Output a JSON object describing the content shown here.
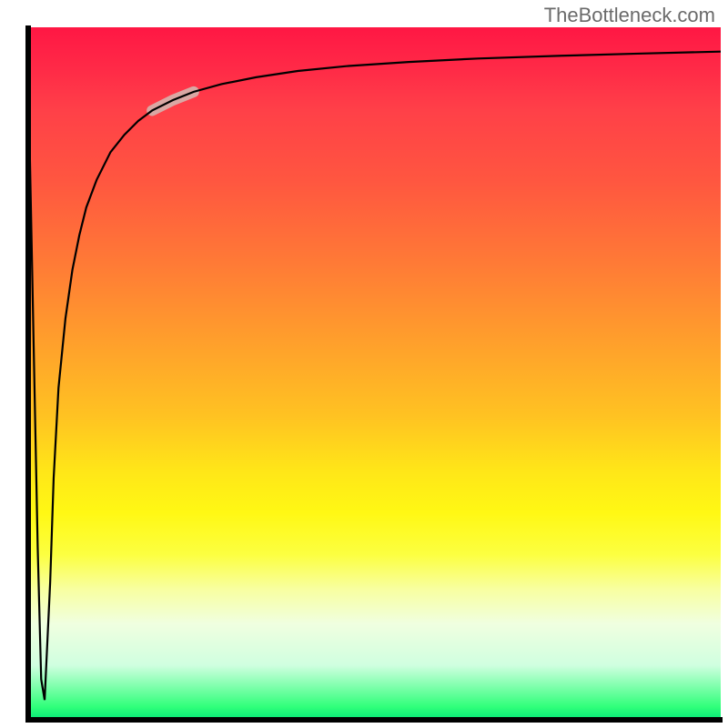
{
  "watermark": "TheBottleneck.com",
  "chart_data": {
    "type": "line",
    "title": "",
    "xlabel": "",
    "ylabel": "",
    "xlim": [
      0,
      100
    ],
    "ylim": [
      0,
      100
    ],
    "grid": false,
    "legend": false,
    "gradient_stops": [
      {
        "pos": 0.0,
        "color": "#ff1744"
      },
      {
        "pos": 0.06,
        "color": "#ff2a47"
      },
      {
        "pos": 0.12,
        "color": "#ff4048"
      },
      {
        "pos": 0.22,
        "color": "#ff5640"
      },
      {
        "pos": 0.34,
        "color": "#ff7a36"
      },
      {
        "pos": 0.45,
        "color": "#ff9e2c"
      },
      {
        "pos": 0.56,
        "color": "#ffc222"
      },
      {
        "pos": 0.64,
        "color": "#ffe618"
      },
      {
        "pos": 0.7,
        "color": "#fff814"
      },
      {
        "pos": 0.76,
        "color": "#fcff40"
      },
      {
        "pos": 0.81,
        "color": "#f8ffa0"
      },
      {
        "pos": 0.86,
        "color": "#f0ffe0"
      },
      {
        "pos": 0.92,
        "color": "#d0ffe0"
      },
      {
        "pos": 0.98,
        "color": "#30ff7a"
      },
      {
        "pos": 1.0,
        "color": "#00e676"
      }
    ],
    "series": [
      {
        "name": "bottleneck-curve",
        "x": [
          0.0,
          0.8,
          1.5,
          2.0,
          2.5,
          3.3,
          3.8,
          4.5,
          5.5,
          6.5,
          7.5,
          8.5,
          10,
          12,
          14,
          16,
          18,
          21,
          24,
          28,
          33,
          39,
          46,
          55,
          65,
          77,
          88,
          100
        ],
        "y": [
          100,
          60,
          25,
          6,
          3,
          20,
          35,
          48,
          58,
          65,
          70,
          74,
          78,
          82,
          84.5,
          86.5,
          88,
          89.5,
          90.7,
          91.8,
          92.8,
          93.7,
          94.4,
          95.0,
          95.5,
          95.9,
          96.2,
          96.5
        ]
      }
    ],
    "highlight_segment": {
      "x_start": 18,
      "x_end": 24,
      "color": "#d9a8a4",
      "width": 12
    }
  },
  "axes": {
    "color": "#000000",
    "thickness_px": 6
  }
}
